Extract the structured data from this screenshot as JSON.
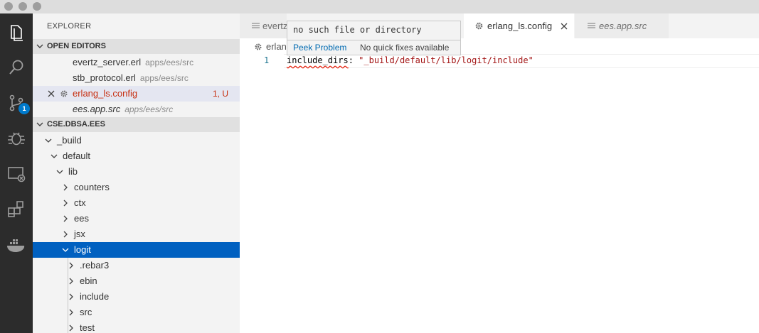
{
  "window": {
    "traffic_lights": [
      "close",
      "minimize",
      "zoom"
    ]
  },
  "activity_bar": {
    "items": [
      {
        "icon": "files-icon"
      },
      {
        "icon": "search-icon"
      },
      {
        "icon": "source-control-icon",
        "badge": "1"
      },
      {
        "icon": "debug-icon"
      },
      {
        "icon": "remote-explorer-icon"
      },
      {
        "icon": "extensions-icon"
      },
      {
        "icon": "docker-icon"
      }
    ]
  },
  "sidebar": {
    "title": "EXPLORER",
    "open_editors": {
      "header": "OPEN EDITORS",
      "items": [
        {
          "name": "evertz_server.erl",
          "path": "apps/ees/src"
        },
        {
          "name": "stb_protocol.erl",
          "path": "apps/ees/src"
        },
        {
          "name": "erlang_ls.config",
          "status": "1, U"
        },
        {
          "name": "ees.app.src",
          "path": "apps/ees/src"
        }
      ]
    },
    "workspace": {
      "header": "CSE.DBSA.EES",
      "tree": [
        {
          "label": "_build"
        },
        {
          "label": "default"
        },
        {
          "label": "lib"
        },
        {
          "label": "counters"
        },
        {
          "label": "ctx"
        },
        {
          "label": "ees"
        },
        {
          "label": "jsx"
        },
        {
          "label": "logit"
        },
        {
          "label": ".rebar3"
        },
        {
          "label": "ebin"
        },
        {
          "label": "include"
        },
        {
          "label": "src"
        },
        {
          "label": "test"
        }
      ]
    }
  },
  "tabs": [
    {
      "label": "evertz"
    },
    {
      "label": "erlang_ls.config",
      "active": true
    },
    {
      "label": "ees.app.src"
    }
  ],
  "editor": {
    "breadcrumb": "erlan",
    "line_number": "1",
    "code_key": "include_dirs",
    "code_sep": ": ",
    "code_value": "\"_build/default/lib/logit/include\""
  },
  "hover": {
    "message": "no such file or directory",
    "peek_label": "Peek Problem",
    "no_fixes": "No quick fixes available"
  },
  "colors": {
    "accent": "#007acc",
    "selection": "#0060c0",
    "error": "#c72e0f",
    "string": "#a31515"
  }
}
